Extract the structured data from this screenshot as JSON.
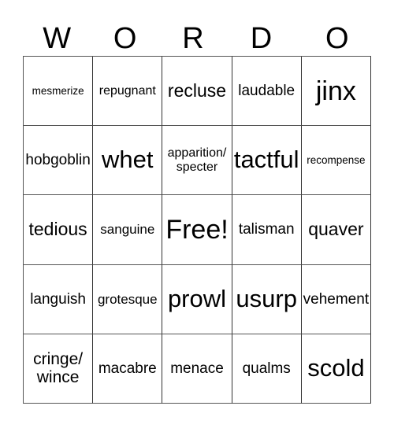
{
  "card": {
    "title_letters": [
      "W",
      "O",
      "R",
      "D",
      "O"
    ],
    "grid_size": "5x5",
    "free_space": "Free!",
    "colors": {
      "text": "#000000",
      "border": "#555555",
      "background": "#ffffff"
    },
    "rows": [
      [
        {
          "text": "mesmerize",
          "size": "xs",
          "lines": 1
        },
        {
          "text": "repugnant",
          "size": "s",
          "lines": 1
        },
        {
          "text": "recluse",
          "size": "l",
          "lines": 1
        },
        {
          "text": "laudable",
          "size": "m",
          "lines": 1
        },
        {
          "text": "jinx",
          "size": "3xl",
          "lines": 1
        }
      ],
      [
        {
          "text": "hobgoblin",
          "size": "m",
          "lines": 1
        },
        {
          "text": "whet",
          "size": "xxl",
          "lines": 1
        },
        {
          "text": "apparition/\nspecter",
          "size": "s",
          "lines": 2
        },
        {
          "text": "tactful",
          "size": "xxl",
          "lines": 1
        },
        {
          "text": "recompense",
          "size": "xs",
          "lines": 1
        }
      ],
      [
        {
          "text": "tedious",
          "size": "l",
          "lines": 1
        },
        {
          "text": "sanguine",
          "size": "sm",
          "lines": 1
        },
        {
          "text": "Free!",
          "size": "3xl",
          "lines": 1
        },
        {
          "text": "talisman",
          "size": "m",
          "lines": 1
        },
        {
          "text": "quaver",
          "size": "l",
          "lines": 1
        }
      ],
      [
        {
          "text": "languish",
          "size": "m",
          "lines": 1
        },
        {
          "text": "grotesque",
          "size": "sm",
          "lines": 1
        },
        {
          "text": "prowl",
          "size": "xxl",
          "lines": 1
        },
        {
          "text": "usurp",
          "size": "xxl",
          "lines": 1
        },
        {
          "text": "vehement",
          "size": "m",
          "lines": 1
        }
      ],
      [
        {
          "text": "cringe/\nwince",
          "size": "ml",
          "lines": 2
        },
        {
          "text": "macabre",
          "size": "m",
          "lines": 1
        },
        {
          "text": "menace",
          "size": "m",
          "lines": 1
        },
        {
          "text": "qualms",
          "size": "m",
          "lines": 1
        },
        {
          "text": "scold",
          "size": "xxl",
          "lines": 1
        }
      ]
    ]
  }
}
